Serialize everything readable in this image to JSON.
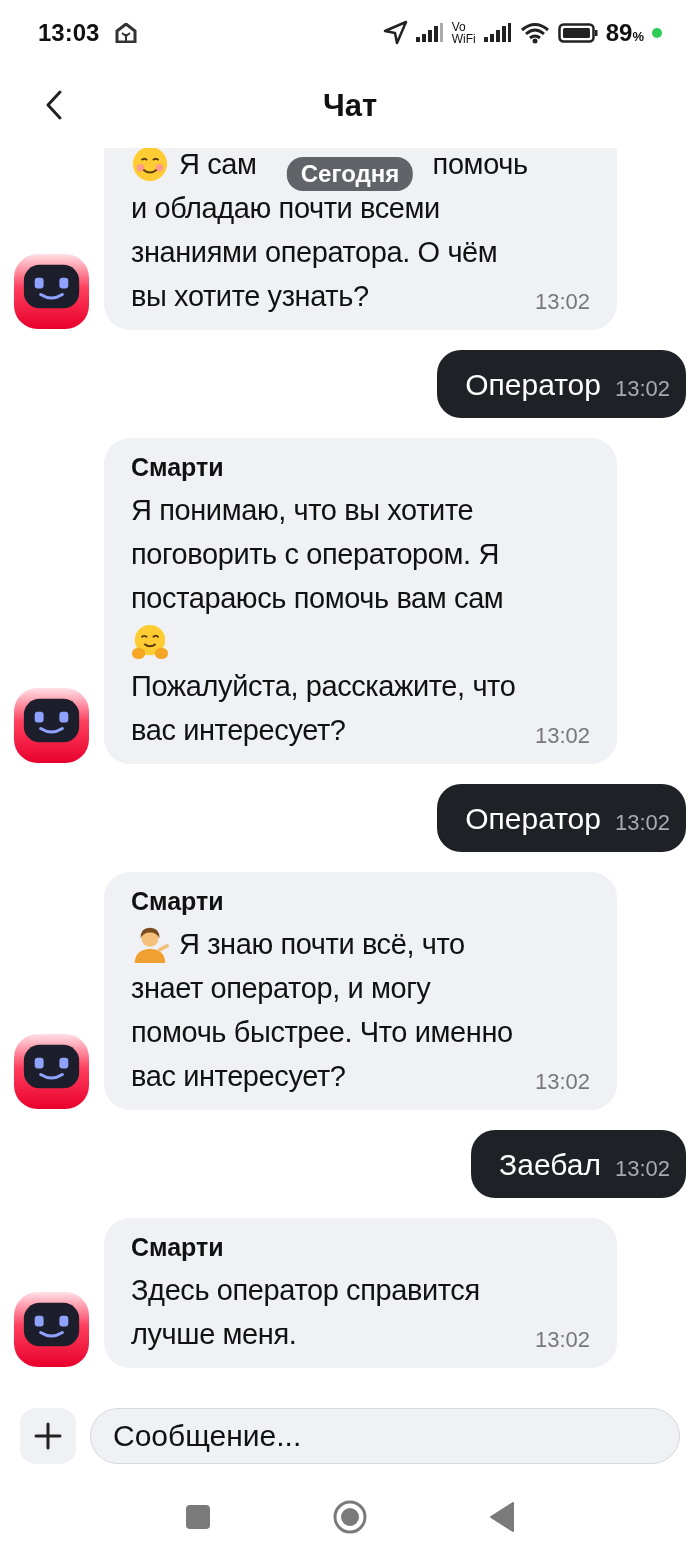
{
  "status_bar": {
    "time": "13:03",
    "wifi_label_top": "Vo",
    "wifi_label_bottom": "WiFi",
    "battery": "89",
    "battery_unit": "%"
  },
  "header": {
    "title": "Чат"
  },
  "date_badge": "Сегодня",
  "messages": [
    {
      "kind": "bot",
      "time": "13:02",
      "lines": [
        {
          "kind": "smile-emoji",
          "text": "Я сам",
          "text_after_badge": "помочь"
        },
        {
          "kind": "text",
          "text": "и обладаю почти всеми"
        },
        {
          "kind": "text",
          "text": "знаниями оператора. О чём"
        },
        {
          "kind": "text",
          "text": "вы хотите узнать?"
        }
      ]
    },
    {
      "kind": "user",
      "text": "Оператор",
      "time": "13:02"
    },
    {
      "kind": "bot",
      "sender": "Смарти",
      "time": "13:02",
      "lines": [
        {
          "kind": "text",
          "text": "Я понимаю, что вы хотите"
        },
        {
          "kind": "text",
          "text": "поговорить с оператором. Я"
        },
        {
          "kind": "text",
          "text": "постараюсь помочь вам сам"
        },
        {
          "kind": "hug-emoji"
        },
        {
          "kind": "text",
          "text": "Пожалуйста, расскажите, что"
        },
        {
          "kind": "text",
          "text": "вас интересует?"
        }
      ]
    },
    {
      "kind": "user",
      "text": "Оператор",
      "time": "13:02"
    },
    {
      "kind": "bot",
      "sender": "Смарти",
      "time": "13:02",
      "lines": [
        {
          "kind": "person-emoji",
          "text": "Я знаю почти всё, что"
        },
        {
          "kind": "text",
          "text": "знает оператор, и могу"
        },
        {
          "kind": "text",
          "text": "помочь быстрее. Что именно"
        },
        {
          "kind": "text",
          "text": "вас интересует?"
        }
      ]
    },
    {
      "kind": "user",
      "text": "Заебал",
      "time": "13:02"
    },
    {
      "kind": "bot",
      "sender": "Смарти",
      "time": "13:02",
      "lines": [
        {
          "kind": "text",
          "text": "Здесь оператор справится"
        },
        {
          "kind": "text",
          "text": "лучше меня."
        }
      ]
    }
  ],
  "composer": {
    "placeholder": "Сообщение..."
  }
}
